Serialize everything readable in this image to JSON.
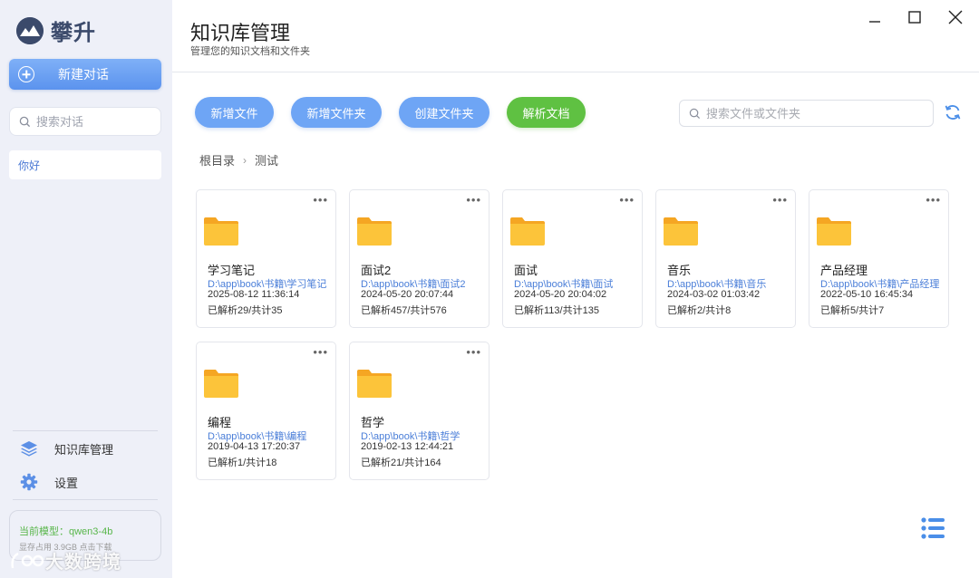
{
  "app": {
    "logo_text": "攀升"
  },
  "sidebar": {
    "new_chat_label": "新建对话",
    "search_placeholder": "搜索对话",
    "chats": [
      "你好"
    ],
    "nav": [
      {
        "label": "知识库管理",
        "icon": "layers-icon"
      },
      {
        "label": "设置",
        "icon": "gear-icon"
      }
    ],
    "model_line": "当前模型：qwen3-4b",
    "model_sub": "显存占用 3.9GB 点击下载",
    "watermark": "大数跨境"
  },
  "header": {
    "title": "知识库管理",
    "subtitle": "管理您的知识文档和文件夹"
  },
  "toolbar": {
    "buttons": [
      "新增文件",
      "新增文件夹",
      "创建文件夹",
      "解析文档"
    ],
    "search_placeholder": "搜索文件或文件夹"
  },
  "breadcrumb": {
    "items": [
      "根目录",
      "测试"
    ]
  },
  "folders": [
    {
      "name": "学习笔记",
      "path": "D:\\app\\book\\书籍\\学习笔记",
      "date": "2025-08-12 11:36:14",
      "stat": "已解析29/共计35"
    },
    {
      "name": "面试2",
      "path": "D:\\app\\book\\书籍\\面试2",
      "date": "2024-05-20 20:07:44",
      "stat": "已解析457/共计576"
    },
    {
      "name": "面试",
      "path": "D:\\app\\book\\书籍\\面试",
      "date": "2024-05-20 20:04:02",
      "stat": "已解析113/共计135"
    },
    {
      "name": "音乐",
      "path": "D:\\app\\book\\书籍\\音乐",
      "date": "2024-03-02 01:03:42",
      "stat": "已解析2/共计8"
    },
    {
      "name": "产品经理",
      "path": "D:\\app\\book\\书籍\\产品经理",
      "date": "2022-05-10 16:45:34",
      "stat": "已解析5/共计7"
    },
    {
      "name": "编程",
      "path": "D:\\app\\book\\书籍\\编程",
      "date": "2019-04-13 17:20:37",
      "stat": "已解析1/共计18"
    },
    {
      "name": "哲学",
      "path": "D:\\app\\book\\书籍\\哲学",
      "date": "2019-02-13 12:44:21",
      "stat": "已解析21/共计164"
    }
  ],
  "colors": {
    "accent_blue": "#6ea5f5",
    "accent_green": "#5fc142",
    "folder": "#fbc02d",
    "sidebar_bg": "#eef0f8"
  }
}
